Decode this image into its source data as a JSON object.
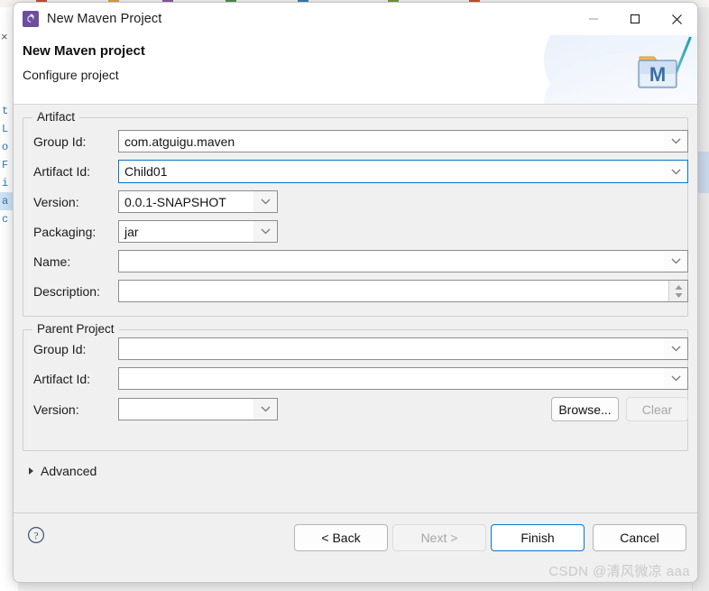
{
  "window": {
    "title": "New Maven Project",
    "icon": "maven-wizard-icon",
    "controls": {
      "minimize": "minimize-icon",
      "maximize": "maximize-icon",
      "close": "close-icon"
    }
  },
  "banner": {
    "title": "New Maven project",
    "subtitle": "Configure project",
    "icon": "maven-folder-m-icon"
  },
  "artifact": {
    "legend": "Artifact",
    "fields": [
      {
        "label": "Group Id:",
        "value": "com.atguigu.maven",
        "placeholder": "",
        "focused": false,
        "control": "combo"
      },
      {
        "label": "Artifact Id:",
        "value": "Child01",
        "placeholder": "",
        "focused": true,
        "control": "combo"
      },
      {
        "label": "Version:",
        "value": "0.0.1-SNAPSHOT",
        "placeholder": "",
        "focused": false,
        "control": "small-combo"
      },
      {
        "label": "Packaging:",
        "value": "jar",
        "placeholder": "",
        "focused": false,
        "control": "small-combo"
      },
      {
        "label": "Name:",
        "value": "",
        "placeholder": "",
        "focused": false,
        "control": "combo"
      },
      {
        "label": "Description:",
        "value": "",
        "placeholder": "",
        "focused": false,
        "control": "spinner-text"
      }
    ]
  },
  "parent": {
    "legend": "Parent Project",
    "fields": [
      {
        "label": "Group Id:",
        "value": "",
        "placeholder": "",
        "focused": false,
        "control": "combo"
      },
      {
        "label": "Artifact Id:",
        "value": "",
        "placeholder": "",
        "focused": false,
        "control": "combo"
      },
      {
        "label": "Version:",
        "value": "",
        "placeholder": "",
        "focused": false,
        "control": "small-combo"
      }
    ],
    "browse_label": "Browse...",
    "clear_label": "Clear",
    "browse_enabled": true,
    "clear_enabled": false
  },
  "advanced": {
    "label": "Advanced",
    "expanded": false,
    "arrow": "chevron-right-icon"
  },
  "footer": {
    "help_icon": "help-circle-icon",
    "buttons": [
      {
        "label": "< Back",
        "enabled": true,
        "default": false
      },
      {
        "label": "Next >",
        "enabled": false,
        "default": false
      },
      {
        "label": "Finish",
        "enabled": true,
        "default": true
      },
      {
        "label": "Cancel",
        "enabled": true,
        "default": false
      }
    ],
    "watermark": "CSDN @清风微凉 aaa"
  },
  "background": {
    "left_lines": [
      "t",
      "L",
      "o",
      "F",
      "i",
      "a",
      "c"
    ],
    "selected_line_index": 5,
    "x_mark": "×",
    "swatch_colors": [
      "#cf4b3c",
      "#e0a33c",
      "#4f8f4f",
      "#8b5aa8",
      "#3c7fb1",
      "#c2562f",
      "#6f9a3c"
    ]
  },
  "colors": {
    "accent": "#0a74c8",
    "dialog_bg": "#f0f0f0",
    "field_bg": "#ffffff",
    "field_border": "#8d8d8d",
    "title_icon": "#6b4e9e",
    "disabled_text": "#a6a6a6",
    "watermark": "#c9c9c9"
  }
}
